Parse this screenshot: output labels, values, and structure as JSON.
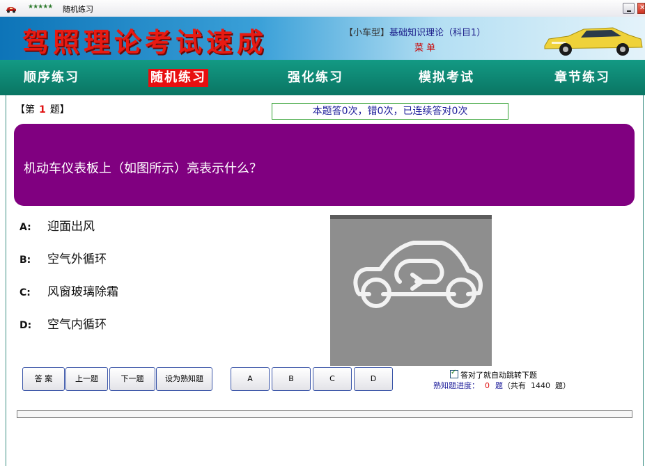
{
  "window": {
    "stars": "★★★★★",
    "title": "随机练习"
  },
  "banner": {
    "brand_title": "驾照理论考试速成",
    "subject_tag": "【小车型】",
    "subject": "基础知识理论（科目1）",
    "menu_label": "菜单"
  },
  "nav": [
    {
      "label": "顺序练习",
      "active": false
    },
    {
      "label": "随机练习",
      "active": true
    },
    {
      "label": "强化练习",
      "active": false
    },
    {
      "label": "模拟考试",
      "active": false
    },
    {
      "label": "章节练习",
      "active": false
    }
  ],
  "question": {
    "number_prefix": "【第",
    "number": "1",
    "number_suffix": "题】",
    "stats": "本题答0次，错0次，已连续答对0次",
    "text": "机动车仪表板上（如图所示）亮表示什么？",
    "image_icon": "air-recirculation-icon"
  },
  "options": [
    {
      "letter": "A:",
      "text": "迎面出风"
    },
    {
      "letter": "B:",
      "text": "空气外循环"
    },
    {
      "letter": "C:",
      "text": "风窗玻璃除霜"
    },
    {
      "letter": "D:",
      "text": "空气内循环"
    }
  ],
  "buttons": {
    "answer": "答 案",
    "prev": "上一题",
    "next": "下一题",
    "mark_known": "设为熟知题",
    "a": "A",
    "b": "B",
    "c": "C",
    "d": "D"
  },
  "settings": {
    "auto_jump_label": "答对了就自动跳转下题",
    "auto_jump_checked": true
  },
  "progress": {
    "label": "熟知题进度：",
    "known": "0",
    "unit": "题",
    "total_prefix": "（共有",
    "total": "1440",
    "total_suffix": "题）"
  },
  "colors": {
    "question_bg": "#800080",
    "nav_bg": "#0f8a75",
    "nav_active": "#e80f10",
    "brand_red": "#e81a12"
  }
}
